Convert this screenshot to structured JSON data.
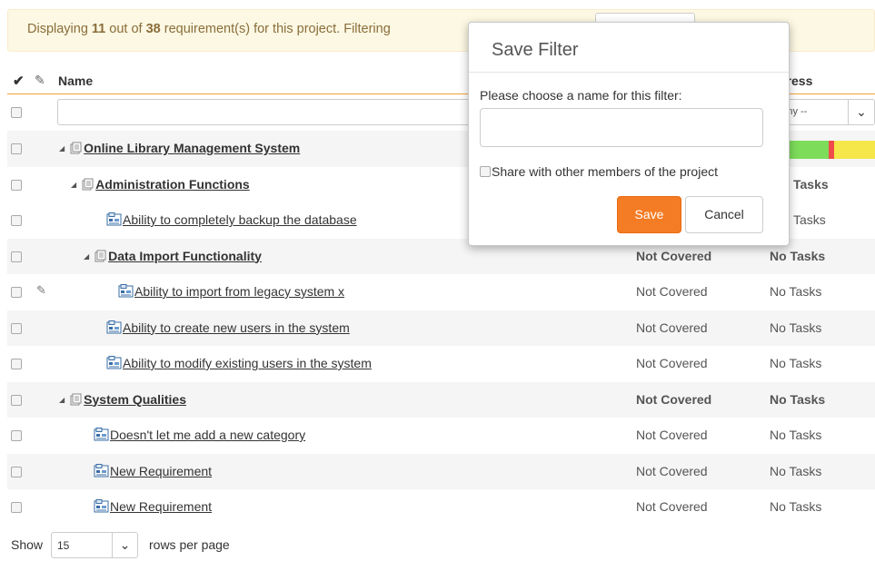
{
  "banner": {
    "prefix": "Displaying ",
    "shown": "11",
    "middle": " out of ",
    "total": "38",
    "suffix": " requirement(s) for this project. Filtering"
  },
  "table": {
    "headers": {
      "check": "✔",
      "attachment": "✎",
      "name": "Name",
      "progress": "gress"
    },
    "progress_filter": "Any --",
    "rows": [
      {
        "indent": 0,
        "type": "folder",
        "expanded": true,
        "label": "Online Library Management System",
        "coverage": "",
        "tasks": "",
        "bold": true,
        "attachment": false,
        "alt": true,
        "progress": [
          {
            "color": "#7ddc5a",
            "fraction": 0.5
          },
          {
            "color": "#f04b4b",
            "fraction": 0.06
          },
          {
            "color": "#f5e64a",
            "fraction": 0.44
          }
        ]
      },
      {
        "indent": 1,
        "type": "folder",
        "expanded": true,
        "label": "Administration Functions",
        "coverage": "",
        "tasks": "Tasks",
        "bold": true,
        "attachment": false,
        "alt": false
      },
      {
        "indent": 2,
        "type": "req",
        "label": "Ability to completely backup the database",
        "coverage": "",
        "tasks": "Tasks",
        "bold": false,
        "attachment": false,
        "alt": false
      },
      {
        "indent": 2,
        "type": "folder",
        "expanded": true,
        "label": "Data Import Functionality",
        "coverage": "Not Covered",
        "tasks": "No Tasks",
        "bold": true,
        "attachment": false,
        "alt": true
      },
      {
        "indent": 3,
        "type": "req",
        "label": "Ability to import from legacy system x",
        "coverage": "Not Covered",
        "tasks": "No Tasks",
        "bold": false,
        "attachment": true,
        "alt": false
      },
      {
        "indent": 2,
        "type": "req",
        "label": "Ability to create new users in the system",
        "coverage": "Not Covered",
        "tasks": "No Tasks",
        "bold": false,
        "attachment": false,
        "alt": true
      },
      {
        "indent": 2,
        "type": "req",
        "label": "Ability to modify existing users in the system",
        "coverage": "Not Covered",
        "tasks": "No Tasks",
        "bold": false,
        "attachment": false,
        "alt": false
      },
      {
        "indent": 0,
        "type": "folder",
        "expanded": true,
        "label": "System Qualities",
        "coverage": "Not Covered",
        "tasks": "No Tasks",
        "bold": true,
        "attachment": false,
        "alt": true
      },
      {
        "indent": 1,
        "type": "req",
        "label": "Doesn't let me add a new category",
        "coverage": "Not Covered",
        "tasks": "No Tasks",
        "bold": false,
        "attachment": false,
        "alt": false
      },
      {
        "indent": 1,
        "type": "req",
        "label": "New Requirement",
        "coverage": "Not Covered",
        "tasks": "No Tasks",
        "bold": false,
        "attachment": false,
        "alt": true
      },
      {
        "indent": 1,
        "type": "req",
        "label": "New Requirement",
        "coverage": "Not Covered",
        "tasks": "No Tasks",
        "bold": false,
        "attachment": false,
        "alt": false
      }
    ]
  },
  "pagination": {
    "show_label": "Show",
    "page_size": "15",
    "rows_per_page_label": "rows per page"
  },
  "modal": {
    "title": "Save Filter",
    "prompt": "Please choose a name for this filter:",
    "name_value": "",
    "share_label": "Share with other members of the project",
    "save_label": "Save",
    "cancel_label": "Cancel"
  },
  "icons": {
    "folder": "folder-icon",
    "requirement": "requirement-icon",
    "expand": "triangle-expanded-icon",
    "attachment": "paperclip-icon",
    "dropdown": "chevron-down-icon"
  },
  "colors": {
    "accent": "#f47c24",
    "banner_bg": "#fcf8e3",
    "banner_text": "#8a6d3b",
    "header_rule": "#f2a23a",
    "row_alt": "#f5f5f5"
  }
}
